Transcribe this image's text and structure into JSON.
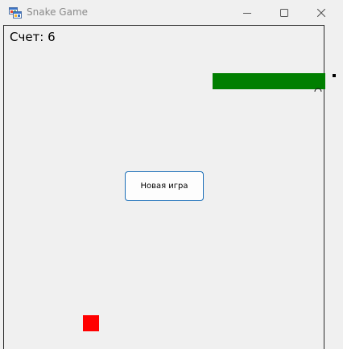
{
  "window": {
    "title": "Snake Game",
    "icon": "app-window-icon",
    "controls": [
      "minimize-icon",
      "maximize-icon",
      "close-icon"
    ]
  },
  "game": {
    "score_text": "Счет: 6",
    "new_game_label": "Новая игра",
    "snake_color": "#007f00",
    "food_color": "#ff0000",
    "border_color": "#2b2b2b"
  }
}
